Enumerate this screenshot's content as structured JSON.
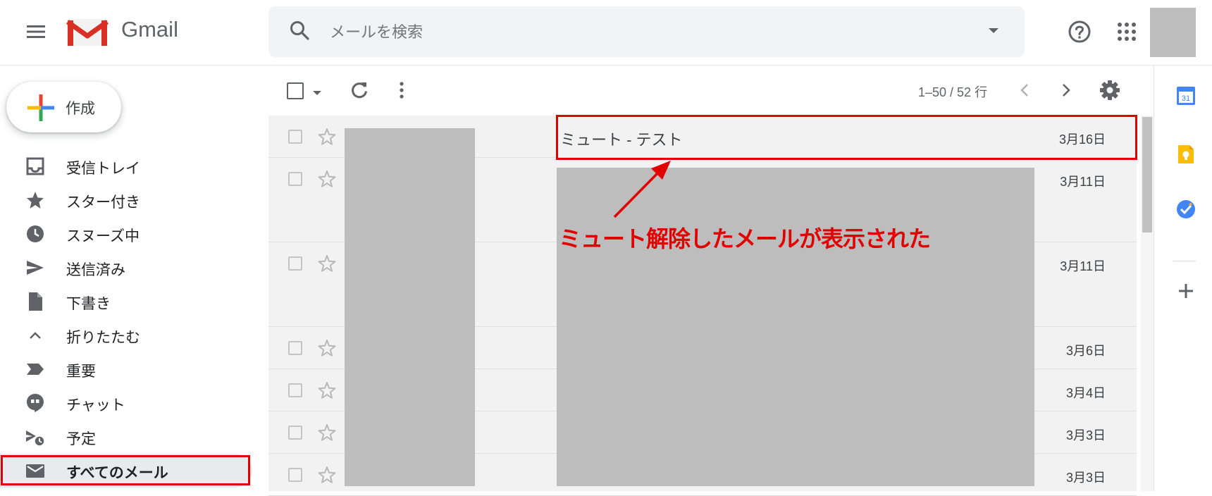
{
  "header": {
    "app_name": "Gmail",
    "search_placeholder": "メールを検索"
  },
  "sidebar": {
    "compose_label": "作成",
    "items": [
      {
        "label": "受信トレイ",
        "icon": "inbox-icon"
      },
      {
        "label": "スター付き",
        "icon": "star-icon"
      },
      {
        "label": "スヌーズ中",
        "icon": "clock-icon"
      },
      {
        "label": "送信済み",
        "icon": "send-icon"
      },
      {
        "label": "下書き",
        "icon": "draft-icon"
      },
      {
        "label": "折りたたむ",
        "icon": "chevron-up-icon"
      },
      {
        "label": "重要",
        "icon": "important-icon"
      },
      {
        "label": "チャット",
        "icon": "chat-icon"
      },
      {
        "label": "予定",
        "icon": "scheduled-icon"
      },
      {
        "label": "すべてのメール",
        "icon": "mail-icon",
        "active": true
      }
    ]
  },
  "toolbar": {
    "page_range": "1–50 / 52 行"
  },
  "messages": [
    {
      "subject": "ミュート - テスト",
      "date": "3月16日"
    },
    {
      "subject": "",
      "date": "3月11日"
    },
    {
      "subject": "",
      "date": "3月11日"
    },
    {
      "subject": "",
      "date": "3月6日"
    },
    {
      "subject": "",
      "date": "3月4日"
    },
    {
      "subject": "",
      "date": "3月3日"
    },
    {
      "subject": "",
      "date": "3月3日"
    }
  ],
  "annotation": {
    "text": "ミュート解除したメールが表示された",
    "color": "#e00000"
  },
  "side_apps": {
    "calendar_day": "31"
  },
  "colors": {
    "gmail_red": "#d93025",
    "highlight_red": "#e00000"
  }
}
